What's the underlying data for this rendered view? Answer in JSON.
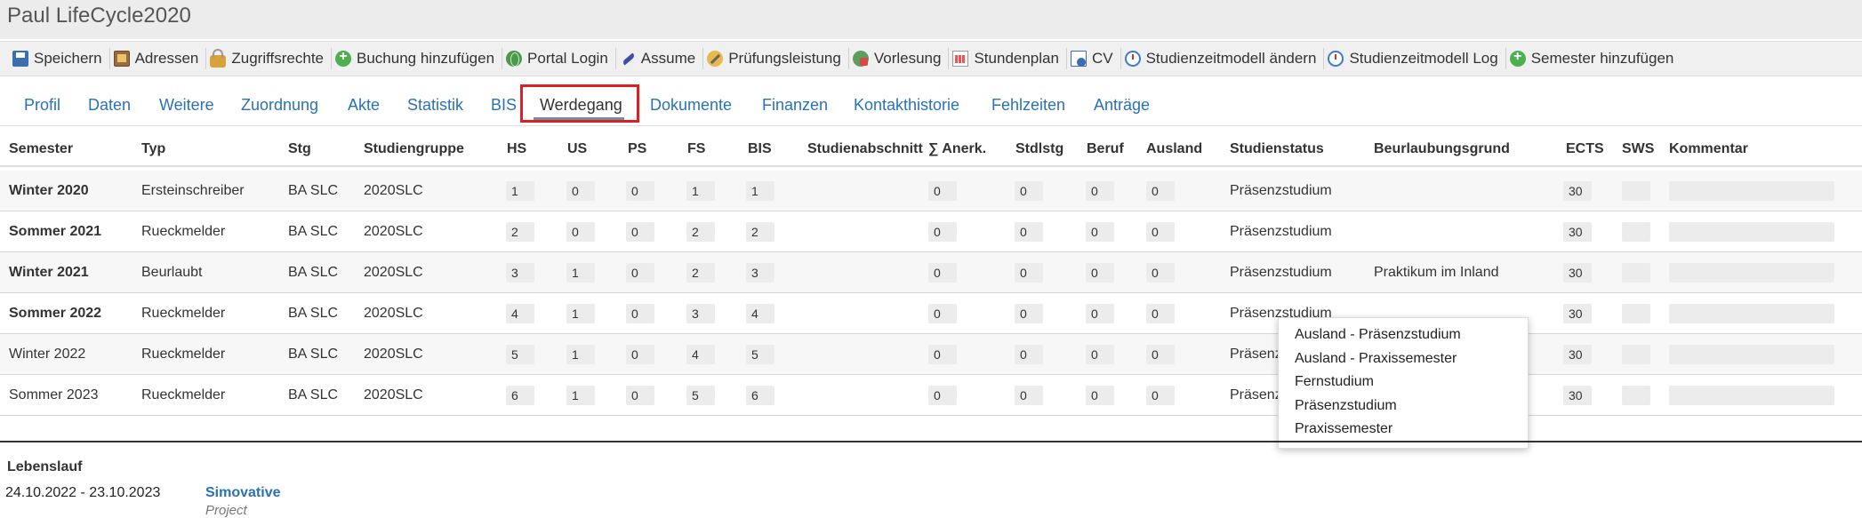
{
  "app_title": "Paul LifeCycle2020",
  "toolbar": [
    {
      "label": "Speichern",
      "icon": "save-icon"
    },
    {
      "label": "Adressen",
      "icon": "address-book-icon"
    },
    {
      "label": "Zugriffsrechte",
      "icon": "lock-icon"
    },
    {
      "label": "Buchung hinzufügen",
      "icon": "add-icon"
    },
    {
      "label": "Portal Login",
      "icon": "globe-icon"
    },
    {
      "label": "Assume",
      "icon": "feather-icon"
    },
    {
      "label": "Prüfungsleistung",
      "icon": "pencil-icon"
    },
    {
      "label": "Vorlesung",
      "icon": "lecture-icon"
    },
    {
      "label": "Stundenplan",
      "icon": "calendar-icon"
    },
    {
      "label": "CV",
      "icon": "document-icon"
    },
    {
      "label": "Studienzeitmodell ändern",
      "icon": "clock-icon"
    },
    {
      "label": "Studienzeitmodell Log",
      "icon": "clock-icon"
    },
    {
      "label": "Semester hinzufügen",
      "icon": "add-icon"
    }
  ],
  "tabs": [
    "Profil",
    "Daten",
    "Weitere",
    "Zuordnung",
    "Akte",
    "Statistik",
    "BIS",
    "Werdegang",
    "Dokumente",
    "Finanzen",
    "Kontakthistorie",
    "Fehlzeiten",
    "Anträge"
  ],
  "active_tab": "Werdegang",
  "table": {
    "headers": [
      "Semester",
      "Typ",
      "Stg",
      "Studiengruppe",
      "HS",
      "US",
      "PS",
      "FS",
      "BIS",
      "Studienabschnitt",
      "∑ Anerk.",
      "Stdlstg",
      "Beruf",
      "Ausland",
      "Studienstatus",
      "Beurlaubungsgrund",
      "ECTS",
      "SWS",
      "Kommentar"
    ],
    "rows": [
      {
        "semester": "Winter 2020",
        "bold": true,
        "typ": "Ersteinschreiber",
        "stg": "BA SLC",
        "gruppe": "2020SLC",
        "hs": "1",
        "us": "0",
        "ps": "0",
        "fs": "1",
        "bis": "1",
        "anerk": "0",
        "stdlstg": "0",
        "beruf": "0",
        "ausland": "0",
        "status": "Präsenzstudium",
        "grund": "",
        "ects": "30"
      },
      {
        "semester": "Sommer 2021",
        "bold": true,
        "typ": "Rueckmelder",
        "stg": "BA SLC",
        "gruppe": "2020SLC",
        "hs": "2",
        "us": "0",
        "ps": "0",
        "fs": "2",
        "bis": "2",
        "anerk": "0",
        "stdlstg": "0",
        "beruf": "0",
        "ausland": "0",
        "status": "Präsenzstudium",
        "grund": "",
        "ects": "30"
      },
      {
        "semester": "Winter 2021",
        "bold": true,
        "typ": "Beurlaubt",
        "stg": "BA SLC",
        "gruppe": "2020SLC",
        "hs": "3",
        "us": "1",
        "ps": "0",
        "fs": "2",
        "bis": "3",
        "anerk": "0",
        "stdlstg": "0",
        "beruf": "0",
        "ausland": "0",
        "status": "Präsenzstudium",
        "grund": "Praktikum im Inland",
        "ects": "30"
      },
      {
        "semester": "Sommer 2022",
        "bold": true,
        "typ": "Rueckmelder",
        "stg": "BA SLC",
        "gruppe": "2020SLC",
        "hs": "4",
        "us": "1",
        "ps": "0",
        "fs": "3",
        "bis": "4",
        "anerk": "0",
        "stdlstg": "0",
        "beruf": "0",
        "ausland": "0",
        "status": "Präsenzstudium",
        "grund": "",
        "ects": "30"
      },
      {
        "semester": "Winter 2022",
        "bold": false,
        "typ": "Rueckmelder",
        "stg": "BA SLC",
        "gruppe": "2020SLC",
        "hs": "5",
        "us": "1",
        "ps": "0",
        "fs": "4",
        "bis": "5",
        "anerk": "0",
        "stdlstg": "0",
        "beruf": "0",
        "ausland": "0",
        "status": "Präsenz",
        "grund": "",
        "ects": "30"
      },
      {
        "semester": "Sommer 2023",
        "bold": false,
        "typ": "Rueckmelder",
        "stg": "BA SLC",
        "gruppe": "2020SLC",
        "hs": "6",
        "us": "1",
        "ps": "0",
        "fs": "5",
        "bis": "6",
        "anerk": "0",
        "stdlstg": "0",
        "beruf": "0",
        "ausland": "0",
        "status": "Präsenz",
        "grund": "",
        "ects": "30"
      }
    ]
  },
  "status_dropdown": {
    "options": [
      "Ausland - Präsenzstudium",
      "Ausland - Praxissemester",
      "Fernstudium",
      "Präsenzstudium",
      "Praxissemester"
    ]
  },
  "lebenslauf": {
    "title": "Lebenslauf",
    "entries": [
      {
        "date": "24.10.2022 - 23.10.2023",
        "name": "Simovative",
        "type": "Project"
      }
    ]
  }
}
